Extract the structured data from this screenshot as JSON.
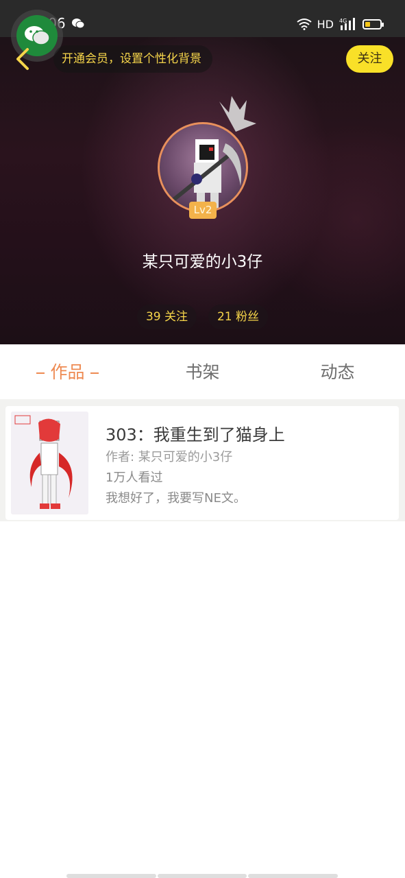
{
  "status_bar": {
    "time": "20:06",
    "network": "HD",
    "signal": "4G"
  },
  "header": {
    "vip_banner": "开通会员，设置个性化背景",
    "follow_button": "关注",
    "level": "Lv2",
    "nickname": "某只可爱的小3仔",
    "following_label": "39 关注",
    "fans_label": "21 粉丝"
  },
  "tabs": [
    {
      "label": "作品"
    },
    {
      "label": "书架"
    },
    {
      "label": "动态"
    }
  ],
  "works": [
    {
      "title": "303：我重生到了猫身上",
      "author": "作者: 某只可爱的小3仔",
      "views": "1万人看过",
      "description": "我想好了，我要写NE文。"
    }
  ],
  "colors": {
    "accent": "#ee8a52",
    "follow_button": "#f9e028",
    "banner_text": "#f6d54a"
  }
}
